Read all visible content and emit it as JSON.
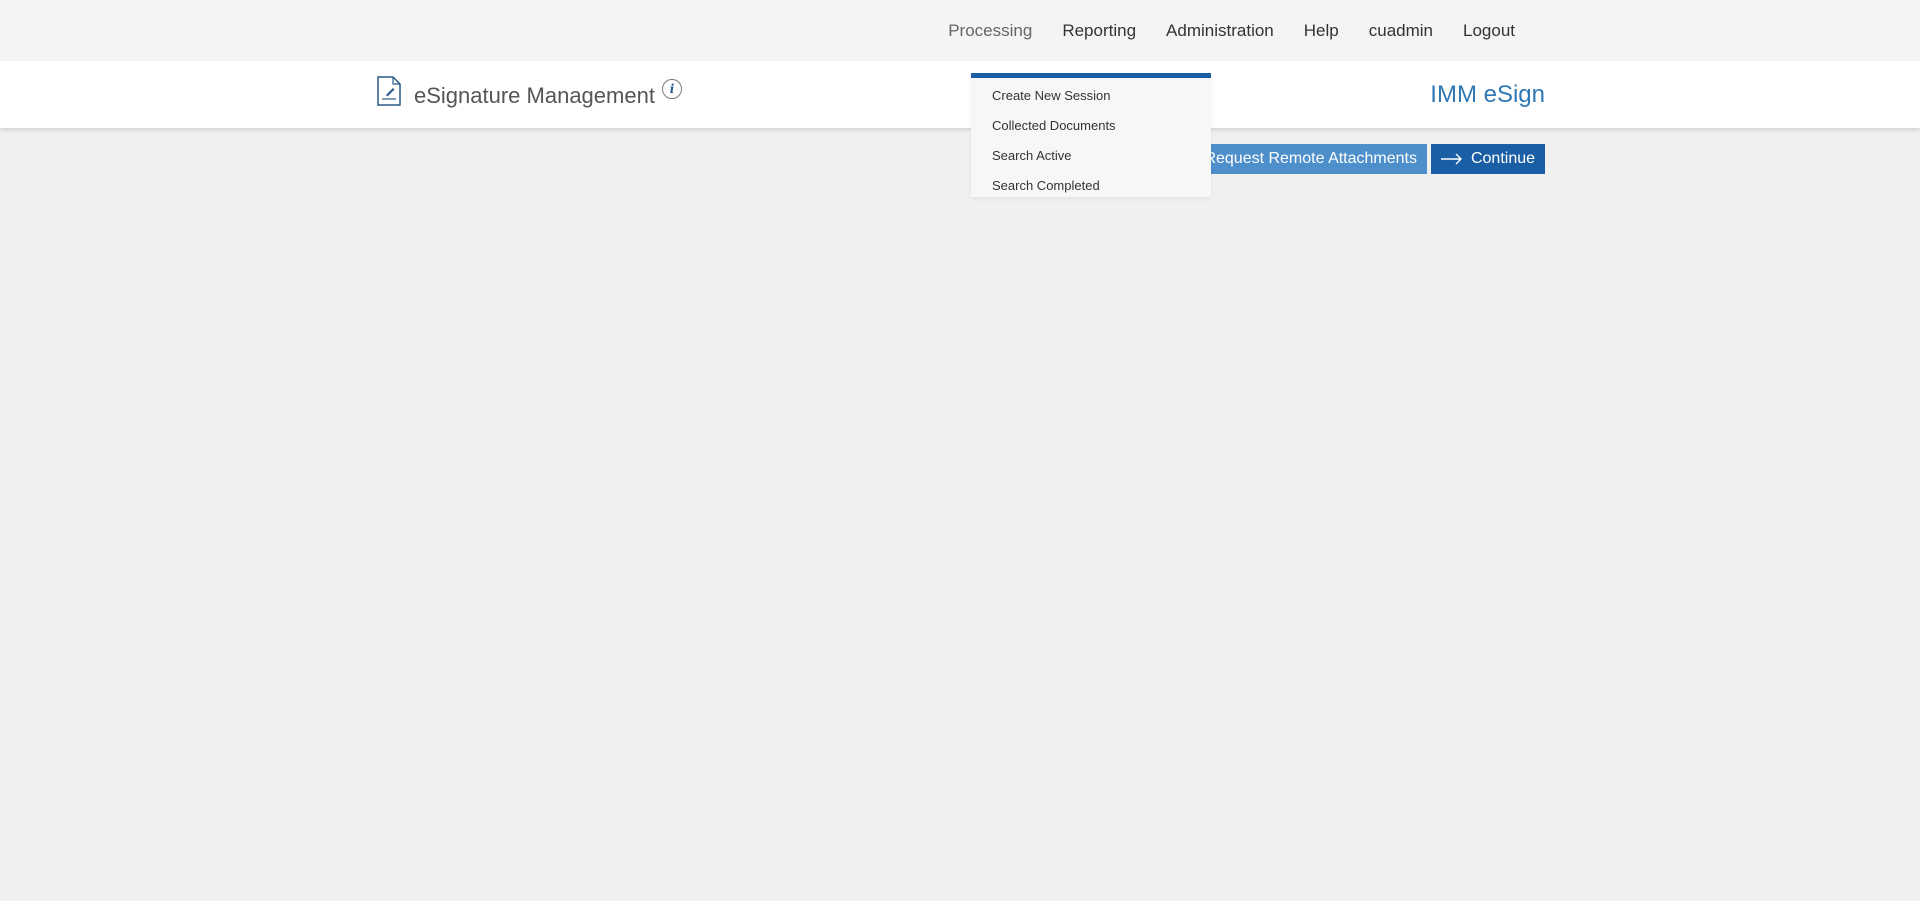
{
  "topnav": {
    "items": [
      {
        "label": "Processing",
        "active": true
      },
      {
        "label": "Reporting"
      },
      {
        "label": "Administration"
      },
      {
        "label": "Help"
      },
      {
        "label": "cuadmin"
      },
      {
        "label": "Logout"
      }
    ]
  },
  "header": {
    "icon": "document-signature-icon",
    "title": "eSignature Management",
    "info_icon_glyph": "i",
    "brand": "IMM eSign"
  },
  "actions": {
    "request_remote_label": "Request Remote Attachments",
    "continue_label": "Continue",
    "continue_icon": "arrow-right-icon"
  },
  "processing_menu": {
    "items": [
      "Create New Session",
      "Collected Documents",
      "Search Active",
      "Search Completed"
    ]
  },
  "colors": {
    "accent": "#1a5fa5",
    "accent_light": "#4d8fca",
    "brand": "#2f78b4",
    "background": "#f0f0f0"
  }
}
